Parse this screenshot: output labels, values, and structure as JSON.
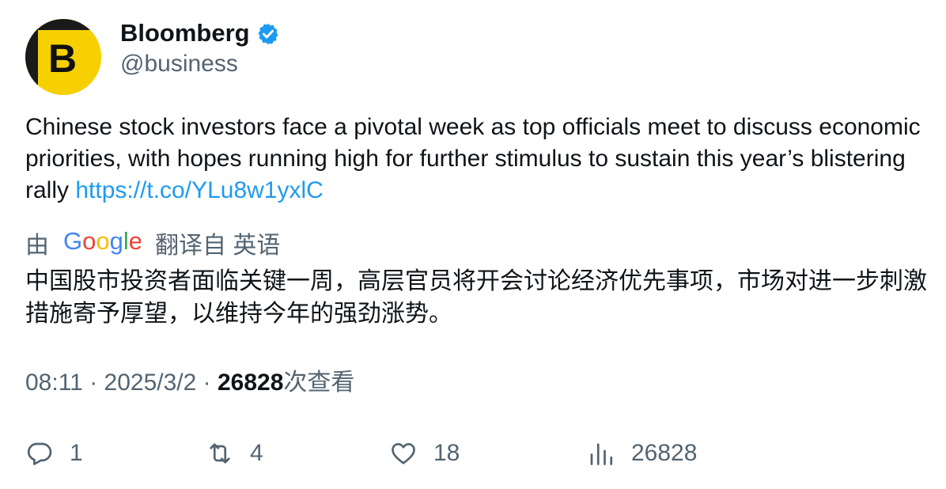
{
  "author": {
    "display_name": "Bloomberg",
    "handle": "@business",
    "verified": true,
    "avatar_letter": "B"
  },
  "tweet": {
    "text": "Chinese stock investors face a pivotal week as top officials meet to discuss economic priorities, with hopes running high for further stimulus to sustain this year’s blistering rally ",
    "link": "https://t.co/YLu8w1yxlC"
  },
  "translation": {
    "prefix": "由",
    "provider_icon": "google-logo",
    "label": "翻译自 英语",
    "text": "中国股市投资者面临关键一周，高层官员将开会讨论经济优先事项，市场对进一步刺激措施寄予厚望，以维持今年的强劲涨势。"
  },
  "meta": {
    "time": "08:11",
    "separator": " · ",
    "date": "2025/3/2",
    "views": "26828",
    "views_suffix": "次查看"
  },
  "actions": {
    "replies": "1",
    "retweets": "4",
    "likes": "18",
    "views": "26828"
  },
  "colors": {
    "text": "#0f1419",
    "secondary": "#536471",
    "link": "#1d9bf0",
    "verified": "#1d9bf0",
    "avatar_bg": "#f6d001"
  }
}
